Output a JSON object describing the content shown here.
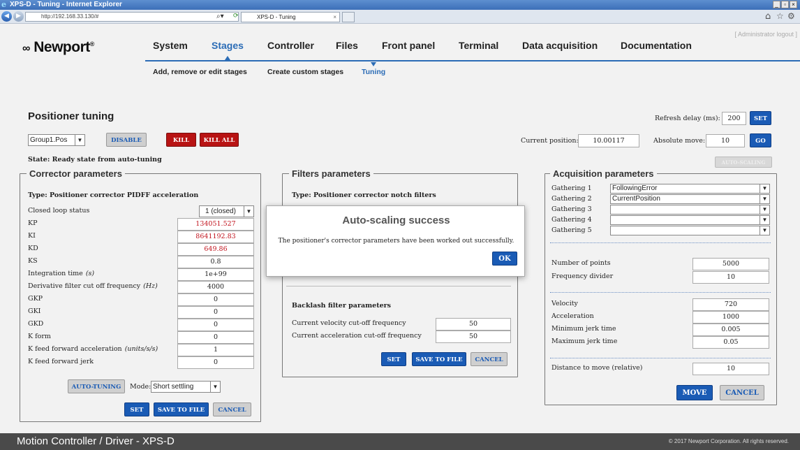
{
  "browser": {
    "title": "XPS-D - Tuning - Internet Explorer",
    "address": "http://192.168.33.130/#",
    "tab_title": "XPS-D - Tuning"
  },
  "header": {
    "logo": "Newport",
    "admin_link": "[ Administrator logout ]",
    "nav": [
      "System",
      "Stages",
      "Controller",
      "Files",
      "Front panel",
      "Terminal",
      "Data acquisition",
      "Documentation"
    ],
    "active_nav": "Stages",
    "subnav": [
      "Add, remove or edit stages",
      "Create custom stages",
      "Tuning"
    ],
    "active_subnav": "Tuning"
  },
  "page": {
    "title": "Positioner tuning",
    "refresh_label": "Refresh delay (ms):",
    "refresh_value": "200",
    "set_label": "SET",
    "group_select": "Group1.Pos",
    "disable_label": "DISABLE",
    "kill_label": "KILL",
    "kill_all_label": "KILL ALL",
    "current_position_label": "Current position:",
    "current_position_value": "10.00117",
    "absolute_move_label": "Absolute move:",
    "absolute_move_value": "10",
    "go_label": "GO",
    "state_text": "State: Ready state from auto-tuning",
    "auto_scaling_label": "AUTO-SCALING"
  },
  "corrector": {
    "title": "Corrector parameters",
    "type_text": "Type: Positioner corrector PIDFF acceleration",
    "closed_loop_label": "Closed loop status",
    "closed_loop_value": "1 (closed)",
    "params": [
      {
        "label": "KP",
        "value": "134051.527",
        "highlight": true
      },
      {
        "label": "KI",
        "value": "8641192.83",
        "highlight": true
      },
      {
        "label": "KD",
        "value": "649.86",
        "highlight": true
      },
      {
        "label": "KS",
        "value": "0.8",
        "highlight": false
      },
      {
        "label": "Integration time",
        "unit": "(s)",
        "value": "1e+99",
        "highlight": false
      },
      {
        "label": "Derivative filter cut off frequency",
        "unit": "(Hz)",
        "value": "4000",
        "highlight": false
      },
      {
        "label": "GKP",
        "value": "0",
        "highlight": false
      },
      {
        "label": "GKI",
        "value": "0",
        "highlight": false
      },
      {
        "label": "GKD",
        "value": "0",
        "highlight": false
      },
      {
        "label": "K form",
        "value": "0",
        "highlight": false
      },
      {
        "label": "K feed forward acceleration",
        "unit": "(units/s/s)",
        "value": "1",
        "highlight": false
      },
      {
        "label": "K feed forward jerk",
        "value": "0",
        "highlight": false
      }
    ],
    "auto_tuning_label": "AUTO-TUNING",
    "mode_label": "Mode:",
    "mode_value": "Short settling",
    "set_label": "SET",
    "save_label": "SAVE TO FILE",
    "cancel_label": "CANCEL"
  },
  "filters": {
    "title": "Filters parameters",
    "type_text": "Type: Positioner corrector notch filters",
    "backlash_title": "Backlash filter parameters",
    "params": [
      {
        "label": "Current velocity cut-off frequency",
        "value": "50"
      },
      {
        "label": "Current acceleration cut-off frequency",
        "value": "50"
      }
    ],
    "set_label": "SET",
    "save_label": "SAVE TO FILE",
    "cancel_label": "CANCEL"
  },
  "acquisition": {
    "title": "Acquisition parameters",
    "gathering": [
      {
        "label": "Gathering 1",
        "value": "FollowingError"
      },
      {
        "label": "Gathering 2",
        "value": "CurrentPosition"
      },
      {
        "label": "Gathering 3",
        "value": ""
      },
      {
        "label": "Gathering 4",
        "value": ""
      },
      {
        "label": "Gathering 5",
        "value": ""
      }
    ],
    "points_label": "Number of points",
    "points_value": "5000",
    "divider_label": "Frequency divider",
    "divider_value": "10",
    "motion": [
      {
        "label": "Velocity",
        "value": "720"
      },
      {
        "label": "Acceleration",
        "value": "1000"
      },
      {
        "label": "Minimum jerk time",
        "value": "0.005"
      },
      {
        "label": "Maximum jerk time",
        "value": "0.05"
      }
    ],
    "distance_label": "Distance to move (relative)",
    "distance_value": "10",
    "move_label": "MOVE",
    "cancel_label": "CANCEL"
  },
  "modal": {
    "title": "Auto-scaling success",
    "message": "The positioner's corrector parameters have been worked out successfully.",
    "ok_label": "OK"
  },
  "footer": {
    "title": "Motion Controller / Driver - XPS-D",
    "copyright": "© 2017 Newport Corporation. All rights reserved."
  },
  "colors": {
    "accent": "#1a5bb5",
    "danger": "#b81414",
    "highlight_text": "#c1121c"
  }
}
